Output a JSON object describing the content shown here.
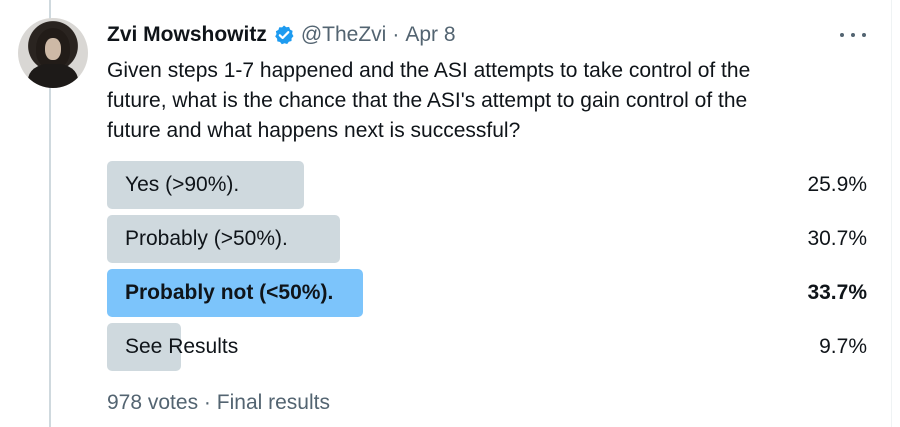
{
  "tweet": {
    "author_name": "Zvi Mowshowitz",
    "handle": "@TheZvi",
    "separator": "·",
    "date": "Apr 8",
    "text_lines": [
      "Given steps 1-7 happened and the ASI attempts to take control of the",
      "future, what is the chance that the ASI's attempt to gain control of the",
      "future and what happens next is successful?"
    ]
  },
  "poll": {
    "options": [
      {
        "label": "Yes (>90%).",
        "percent_text": "25.9%",
        "fraction": 0.259,
        "winner": false
      },
      {
        "label": "Probably (>50%).",
        "percent_text": "30.7%",
        "fraction": 0.307,
        "winner": false
      },
      {
        "label": "Probably not (<50%).",
        "percent_text": "33.7%",
        "fraction": 0.337,
        "winner": true
      },
      {
        "label": "See Results",
        "percent_text": "9.7%",
        "fraction": 0.097,
        "winner": false
      }
    ],
    "votes": "978 votes",
    "separator": "·",
    "status": "Final results"
  },
  "colors": {
    "winner_bar": "#7cc4fb",
    "bar": "#cfd9de",
    "verified": "#1d9bf0",
    "secondary_text": "#536471"
  },
  "icons": {
    "verified": "verified-badge-icon",
    "more": "more-options-icon"
  }
}
